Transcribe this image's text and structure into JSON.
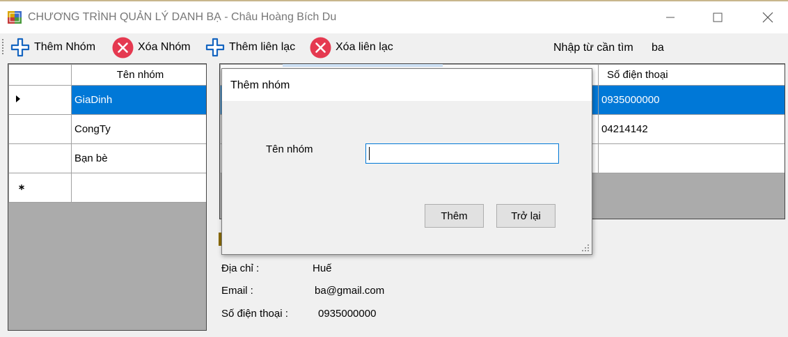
{
  "window": {
    "title": "CHƯƠNG TRÌNH QUẢN LÝ DANH BẠ - Châu Hoàng Bích Du",
    "minimize_icon": "minimize-icon",
    "maximize_icon": "maximize-icon",
    "close_icon": "close-icon"
  },
  "toolbar": {
    "add_group": {
      "label": "Thêm Nhóm",
      "icon": "plus-icon"
    },
    "delete_group": {
      "label": "Xóa Nhóm",
      "icon": "delete-icon"
    },
    "add_contact": {
      "label": "Thêm liên lạc",
      "icon": "plus-icon"
    },
    "delete_contact": {
      "label": "Xóa liên lạc",
      "icon": "delete-icon"
    },
    "search_label": "Nhập từ cần tìm",
    "search_value": "ba"
  },
  "groups_grid": {
    "header": "Tên nhóm",
    "rows": [
      "GiaDinh",
      "CongTy",
      "Bạn bè"
    ],
    "selected_row": 0,
    "current_row_icon": "row-pointer-icon",
    "new_row_icon": "new-row-asterisk-icon"
  },
  "contacts_grid": {
    "phone_header": "Số điện thoại",
    "phones": [
      "0935000000",
      "04214142"
    ],
    "selected_row": 0
  },
  "details": {
    "address_label": "Địa chỉ :",
    "address_value": "Huế",
    "email_label": "Email :",
    "email_value": "ba@gmail.com",
    "phone_label": "Số điện thoại :",
    "phone_value": "0935000000"
  },
  "colors": {
    "selection": "#0078d7",
    "plus_icon": "#1565c0",
    "delete_icon": "#e53950"
  },
  "dialog": {
    "title": "Thêm nhóm",
    "field_label": "Tên nhóm",
    "field_value": "",
    "add_button": "Thêm",
    "back_button": "Trở lại"
  }
}
